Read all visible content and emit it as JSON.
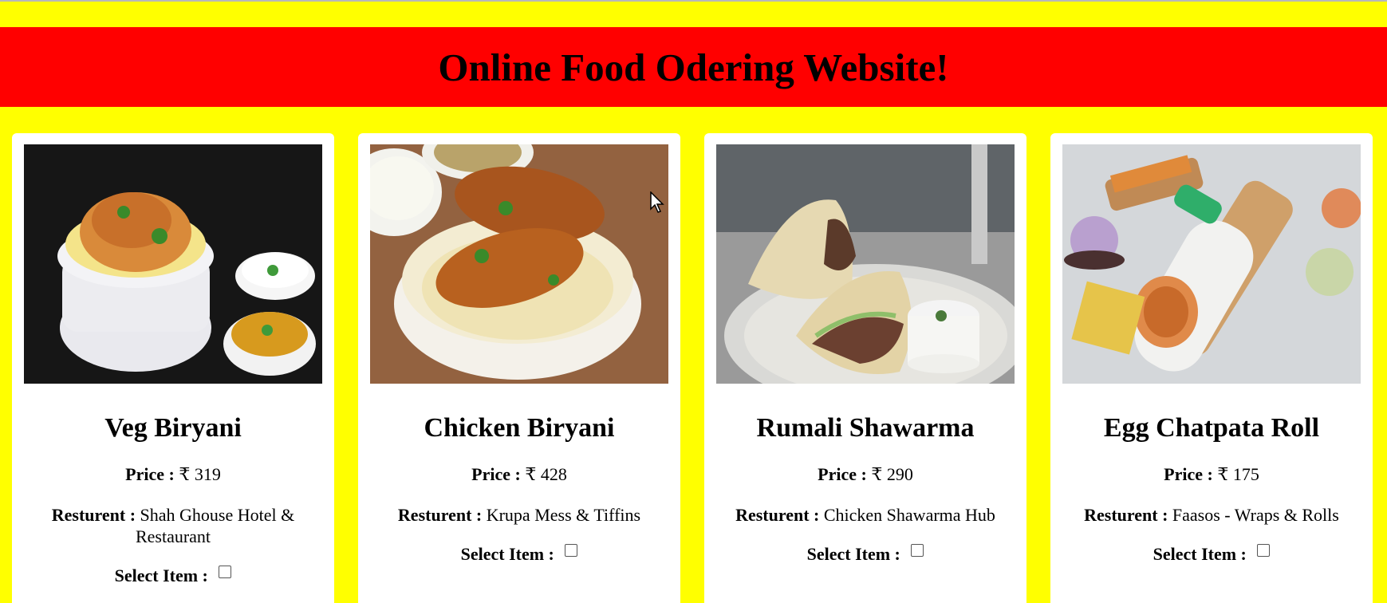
{
  "header": {
    "title": "Online Food Odering Website!"
  },
  "labels": {
    "price": "Price :",
    "restaurant": "Resturent :",
    "select": "Select Item :"
  },
  "items": [
    {
      "name": "Veg Biryani",
      "price": "₹ 319",
      "restaurant": "Shah Ghouse Hotel & Restaurant",
      "image_icon": "veg-biryani-photo"
    },
    {
      "name": "Chicken Biryani",
      "price": "₹ 428",
      "restaurant": "Krupa Mess & Tiffins",
      "image_icon": "chicken-biryani-photo"
    },
    {
      "name": "Rumali Shawarma",
      "price": "₹ 290",
      "restaurant": "Chicken Shawarma Hub",
      "image_icon": "rumali-shawarma-photo"
    },
    {
      "name": "Egg Chatpata Roll",
      "price": "₹ 175",
      "restaurant": "Faasos - Wraps & Rolls",
      "image_icon": "egg-roll-photo"
    }
  ],
  "colors": {
    "background": "#ffff00",
    "header": "#ff0000",
    "card": "#ffffff"
  }
}
